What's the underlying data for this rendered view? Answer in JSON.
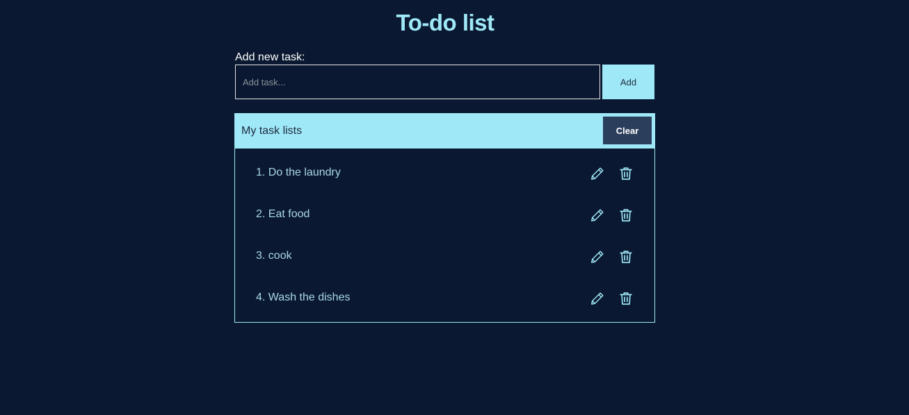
{
  "header": {
    "title": "To-do list"
  },
  "form": {
    "label": "Add new task:",
    "input_value": "",
    "input_placeholder": "Add task...",
    "add_label": "Add"
  },
  "task_list": {
    "title": "My task lists",
    "clear_label": "Clear",
    "items": [
      {
        "text": "1. Do the laundry"
      },
      {
        "text": "2. Eat food"
      },
      {
        "text": "3. cook"
      },
      {
        "text": "4. Wash the dishes"
      }
    ]
  },
  "icons": {
    "edit": "pencil-icon",
    "delete": "trash-icon"
  },
  "colors": {
    "background": "#0a1931",
    "accent": "#9fe8f7",
    "clear_button": "#2b3e5c",
    "task_text": "#a9d6e8"
  }
}
